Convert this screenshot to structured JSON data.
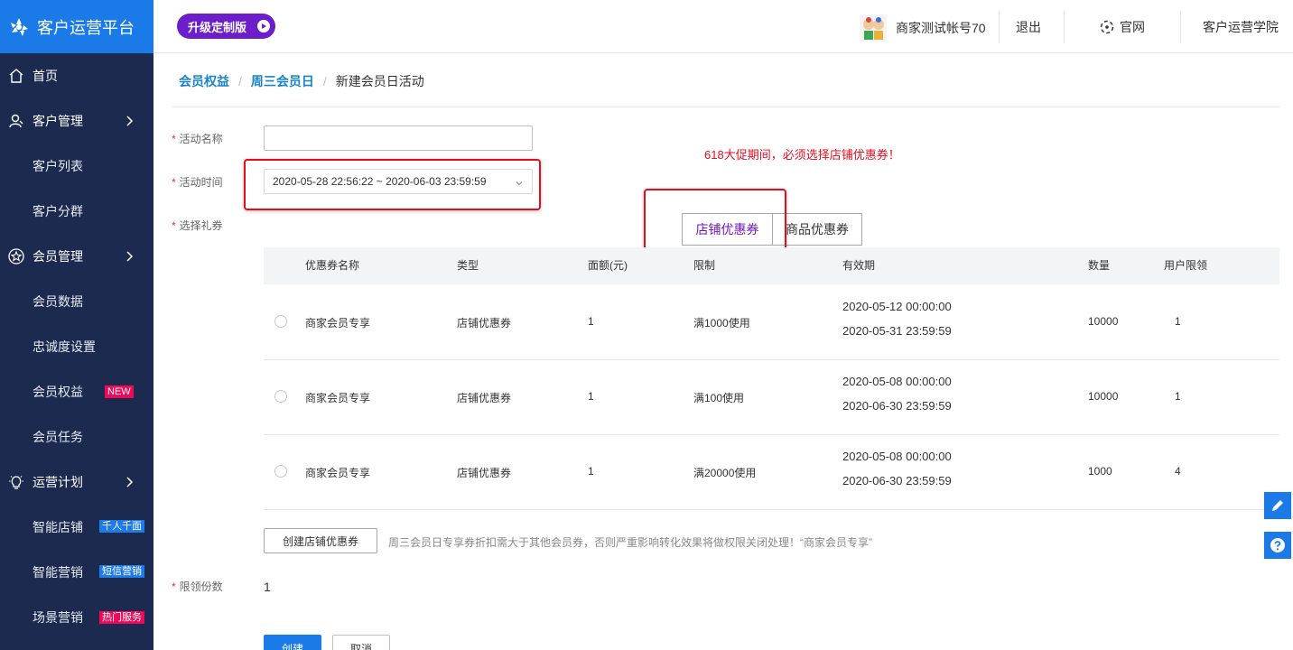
{
  "brand": {
    "title": "客户运营平台"
  },
  "sidebar": {
    "home": "首页",
    "customer_mgmt": "客户管理",
    "customer_list": "客户列表",
    "customer_group": "客户分群",
    "member_mgmt": "会员管理",
    "member_data": "会员数据",
    "loyalty": "忠诚度设置",
    "member_rights": "会员权益",
    "member_rights_badge": "NEW",
    "member_task": "会员任务",
    "ops_plan": "运营计划",
    "smart_store": "智能店铺",
    "smart_store_badge": "千人千面",
    "smart_marketing": "智能营销",
    "smart_marketing_badge": "短信营销",
    "scene_marketing": "场景营销",
    "scene_marketing_badge": "热门服务"
  },
  "topbar": {
    "upgrade": "升级定制版",
    "account": "商家测试帐号70",
    "logout": "退出",
    "official": "官网",
    "academy": "客户运营学院"
  },
  "breadcrumb": {
    "l1": "会员权益",
    "l2": "周三会员日",
    "current": "新建会员日活动"
  },
  "form": {
    "name_label": "活动名称",
    "name_value": "",
    "time_label": "活动时间",
    "time_value": "2020-05-28 22:56:22 ~ 2020-06-03 23:59:59",
    "coupon_label": "选择礼券",
    "limit_label": "限领份数",
    "limit_value": "1",
    "required_mark": "*"
  },
  "warning": "618大促期间，必须选择店铺优惠券！",
  "tabs": [
    "店铺优惠券",
    "商品优惠券"
  ],
  "table": {
    "headers": [
      "优惠券名称",
      "类型",
      "面额(元)",
      "限制",
      "有效期",
      "数量",
      "用户限领"
    ],
    "rows": [
      {
        "name": "商家会员专享",
        "type": "店铺优惠券",
        "value": "1",
        "limit": "满1000使用",
        "start": "2020-05-12 00:00:00",
        "end": "2020-05-31 23:59:59",
        "qty": "10000",
        "per_user": "1"
      },
      {
        "name": "商家会员专享",
        "type": "店铺优惠券",
        "value": "1",
        "limit": "满100使用",
        "start": "2020-05-08 00:00:00",
        "end": "2020-06-30 23:59:59",
        "qty": "10000",
        "per_user": "1"
      },
      {
        "name": "商家会员专享",
        "type": "店铺优惠券",
        "value": "1",
        "limit": "满20000使用",
        "start": "2020-05-08 00:00:00",
        "end": "2020-06-30 23:59:59",
        "qty": "1000",
        "per_user": "4"
      }
    ]
  },
  "create_coupon": "创建店铺优惠券",
  "hint": "周三会员日专享券折扣需大于其他会员券，否则严重影响转化效果将做权限关闭处理！“商家会员专享”",
  "actions": {
    "create": "创建",
    "cancel": "取消"
  },
  "colors": {
    "sidebar": "#1c2a4f",
    "brand": "#1a7ae8",
    "upgrade": "#6b1ec9",
    "annotation": "#e60b1f",
    "link": "#1a84c7"
  },
  "icons": [
    "logo-icon",
    "home-icon",
    "user-icon",
    "star-icon",
    "bulb-icon",
    "chevron-right-icon",
    "play-icon",
    "compass-icon",
    "chevron-down-icon",
    "edit-icon",
    "help-icon"
  ]
}
